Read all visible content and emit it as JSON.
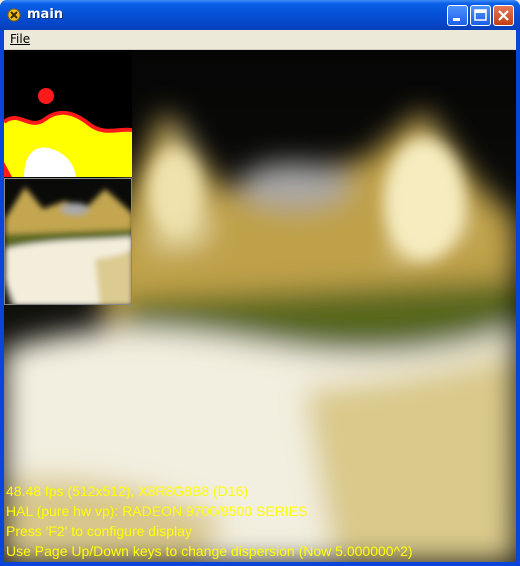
{
  "window": {
    "title": "main"
  },
  "menubar": {
    "items": [
      {
        "label": "File"
      }
    ]
  },
  "overlay": {
    "lines": [
      "48.48 fps (512x512), X8R8G8B8 (D16)",
      "HAL (pure hw vp): RADEON 9700/9500 SERIES",
      "Press 'F2' to configure display",
      "Use Page Up/Down keys to change dispersion (Now 5.000000^2)"
    ]
  },
  "colors": {
    "overlay_text": "#ffff00",
    "titlebar": "#0552d6",
    "terrain_gold": "#c8a84a",
    "snow": "#f4f1e6",
    "grass": "#5a6a1e"
  }
}
